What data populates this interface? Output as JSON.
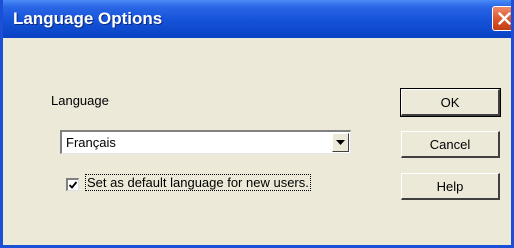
{
  "window": {
    "title": "Language Options",
    "close_icon": "close-icon",
    "accent_color": "#1a4fd6"
  },
  "form": {
    "language_label": "Language",
    "language_select": {
      "selected": "Français",
      "dropdown_icon": "chevron-down-icon"
    },
    "default_checkbox": {
      "checked": true,
      "label": "Set as default language for new users."
    }
  },
  "buttons": {
    "ok": "OK",
    "cancel": "Cancel",
    "help": "Help"
  }
}
